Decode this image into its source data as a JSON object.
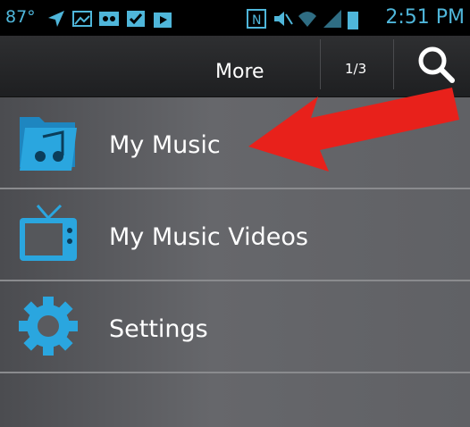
{
  "status_bar": {
    "temperature": "87°",
    "time": "2:51 PM"
  },
  "action_bar": {
    "title": "More",
    "page_indicator": "1/3"
  },
  "menu": {
    "items": [
      {
        "label": "My Music",
        "icon": "music-folder-icon"
      },
      {
        "label": "My Music Videos",
        "icon": "tv-icon"
      },
      {
        "label": "Settings",
        "icon": "gear-icon"
      }
    ]
  },
  "colors": {
    "accent": "#2aa6df",
    "annotation": "#e8211b"
  }
}
